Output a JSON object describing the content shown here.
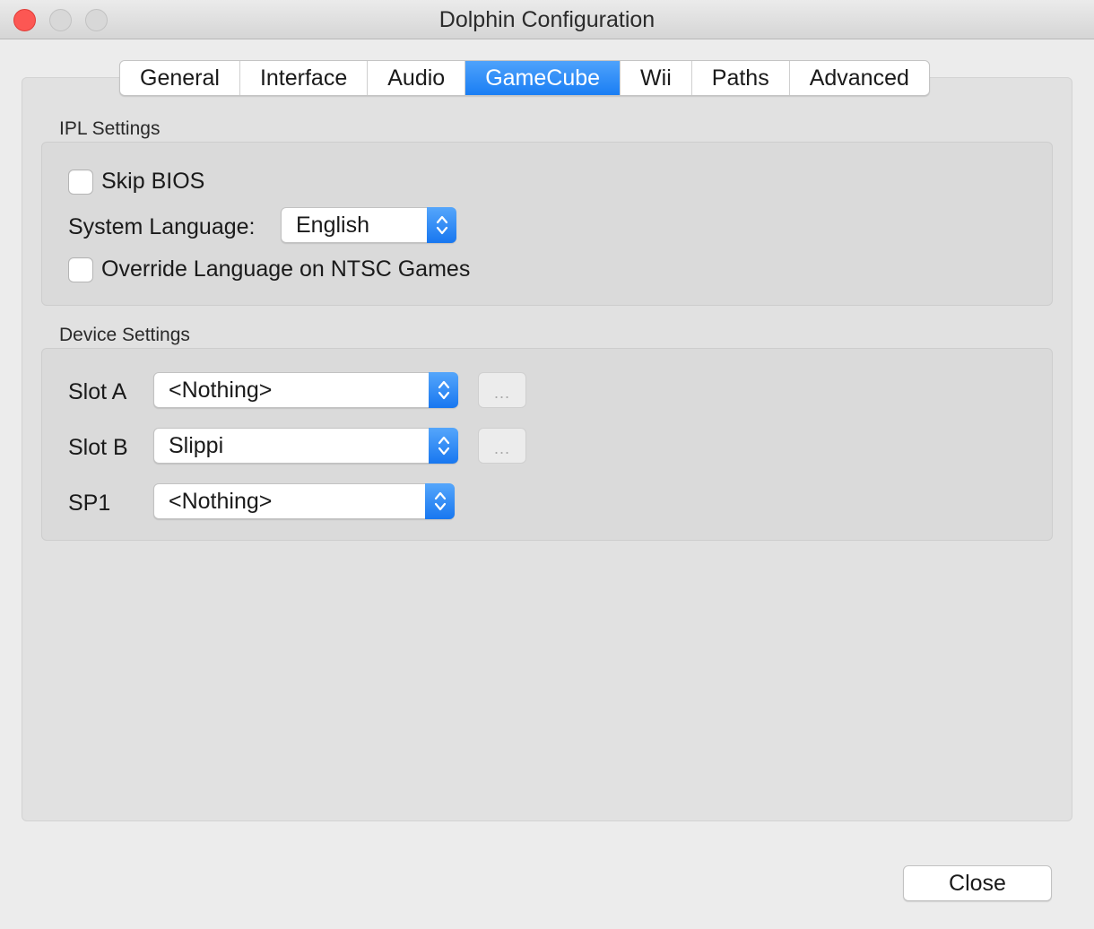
{
  "window": {
    "title": "Dolphin Configuration",
    "accent_color": "#1a7ef4",
    "close_color": "#fc5753"
  },
  "tabs": [
    {
      "label": "General",
      "active": false
    },
    {
      "label": "Interface",
      "active": false
    },
    {
      "label": "Audio",
      "active": false
    },
    {
      "label": "GameCube",
      "active": true
    },
    {
      "label": "Wii",
      "active": false
    },
    {
      "label": "Paths",
      "active": false
    },
    {
      "label": "Advanced",
      "active": false
    }
  ],
  "ipl": {
    "group_label": "IPL Settings",
    "skip_bios": {
      "label": "Skip BIOS",
      "checked": false
    },
    "system_language": {
      "label": "System Language:",
      "value": "English"
    },
    "override_language": {
      "label": "Override Language on NTSC Games",
      "checked": false
    }
  },
  "device": {
    "group_label": "Device Settings",
    "slot_a": {
      "label": "Slot A",
      "value": "<Nothing>",
      "config_button": "..."
    },
    "slot_b": {
      "label": "Slot B",
      "value": "Slippi",
      "config_button": "..."
    },
    "sp1": {
      "label": "SP1",
      "value": "<Nothing>"
    }
  },
  "footer": {
    "close_label": "Close"
  },
  "icons": {
    "popup_arrows": "chevron-up-down-icon",
    "window_close": "close-icon",
    "window_minimize": "minimize-icon",
    "window_zoom": "zoom-icon"
  }
}
